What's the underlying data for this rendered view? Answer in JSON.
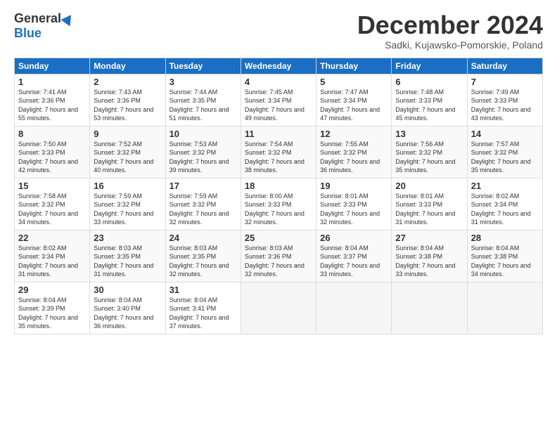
{
  "header": {
    "logo_general": "General",
    "logo_blue": "Blue",
    "month_title": "December 2024",
    "subtitle": "Sadki, Kujawsko-Pomorskie, Poland"
  },
  "days_of_week": [
    "Sunday",
    "Monday",
    "Tuesday",
    "Wednesday",
    "Thursday",
    "Friday",
    "Saturday"
  ],
  "weeks": [
    [
      {
        "day": "1",
        "sunrise": "Sunrise: 7:41 AM",
        "sunset": "Sunset: 3:36 PM",
        "daylight": "Daylight: 7 hours and 55 minutes."
      },
      {
        "day": "2",
        "sunrise": "Sunrise: 7:43 AM",
        "sunset": "Sunset: 3:36 PM",
        "daylight": "Daylight: 7 hours and 53 minutes."
      },
      {
        "day": "3",
        "sunrise": "Sunrise: 7:44 AM",
        "sunset": "Sunset: 3:35 PM",
        "daylight": "Daylight: 7 hours and 51 minutes."
      },
      {
        "day": "4",
        "sunrise": "Sunrise: 7:45 AM",
        "sunset": "Sunset: 3:34 PM",
        "daylight": "Daylight: 7 hours and 49 minutes."
      },
      {
        "day": "5",
        "sunrise": "Sunrise: 7:47 AM",
        "sunset": "Sunset: 3:34 PM",
        "daylight": "Daylight: 7 hours and 47 minutes."
      },
      {
        "day": "6",
        "sunrise": "Sunrise: 7:48 AM",
        "sunset": "Sunset: 3:33 PM",
        "daylight": "Daylight: 7 hours and 45 minutes."
      },
      {
        "day": "7",
        "sunrise": "Sunrise: 7:49 AM",
        "sunset": "Sunset: 3:33 PM",
        "daylight": "Daylight: 7 hours and 43 minutes."
      }
    ],
    [
      {
        "day": "8",
        "sunrise": "Sunrise: 7:50 AM",
        "sunset": "Sunset: 3:33 PM",
        "daylight": "Daylight: 7 hours and 42 minutes."
      },
      {
        "day": "9",
        "sunrise": "Sunrise: 7:52 AM",
        "sunset": "Sunset: 3:32 PM",
        "daylight": "Daylight: 7 hours and 40 minutes."
      },
      {
        "day": "10",
        "sunrise": "Sunrise: 7:53 AM",
        "sunset": "Sunset: 3:32 PM",
        "daylight": "Daylight: 7 hours and 39 minutes."
      },
      {
        "day": "11",
        "sunrise": "Sunrise: 7:54 AM",
        "sunset": "Sunset: 3:32 PM",
        "daylight": "Daylight: 7 hours and 38 minutes."
      },
      {
        "day": "12",
        "sunrise": "Sunrise: 7:55 AM",
        "sunset": "Sunset: 3:32 PM",
        "daylight": "Daylight: 7 hours and 36 minutes."
      },
      {
        "day": "13",
        "sunrise": "Sunrise: 7:56 AM",
        "sunset": "Sunset: 3:32 PM",
        "daylight": "Daylight: 7 hours and 35 minutes."
      },
      {
        "day": "14",
        "sunrise": "Sunrise: 7:57 AM",
        "sunset": "Sunset: 3:32 PM",
        "daylight": "Daylight: 7 hours and 35 minutes."
      }
    ],
    [
      {
        "day": "15",
        "sunrise": "Sunrise: 7:58 AM",
        "sunset": "Sunset: 3:32 PM",
        "daylight": "Daylight: 7 hours and 34 minutes."
      },
      {
        "day": "16",
        "sunrise": "Sunrise: 7:59 AM",
        "sunset": "Sunset: 3:32 PM",
        "daylight": "Daylight: 7 hours and 33 minutes."
      },
      {
        "day": "17",
        "sunrise": "Sunrise: 7:59 AM",
        "sunset": "Sunset: 3:32 PM",
        "daylight": "Daylight: 7 hours and 32 minutes."
      },
      {
        "day": "18",
        "sunrise": "Sunrise: 8:00 AM",
        "sunset": "Sunset: 3:33 PM",
        "daylight": "Daylight: 7 hours and 32 minutes."
      },
      {
        "day": "19",
        "sunrise": "Sunrise: 8:01 AM",
        "sunset": "Sunset: 3:33 PM",
        "daylight": "Daylight: 7 hours and 32 minutes."
      },
      {
        "day": "20",
        "sunrise": "Sunrise: 8:01 AM",
        "sunset": "Sunset: 3:33 PM",
        "daylight": "Daylight: 7 hours and 31 minutes."
      },
      {
        "day": "21",
        "sunrise": "Sunrise: 8:02 AM",
        "sunset": "Sunset: 3:34 PM",
        "daylight": "Daylight: 7 hours and 31 minutes."
      }
    ],
    [
      {
        "day": "22",
        "sunrise": "Sunrise: 8:02 AM",
        "sunset": "Sunset: 3:34 PM",
        "daylight": "Daylight: 7 hours and 31 minutes."
      },
      {
        "day": "23",
        "sunrise": "Sunrise: 8:03 AM",
        "sunset": "Sunset: 3:35 PM",
        "daylight": "Daylight: 7 hours and 31 minutes."
      },
      {
        "day": "24",
        "sunrise": "Sunrise: 8:03 AM",
        "sunset": "Sunset: 3:35 PM",
        "daylight": "Daylight: 7 hours and 32 minutes."
      },
      {
        "day": "25",
        "sunrise": "Sunrise: 8:03 AM",
        "sunset": "Sunset: 3:36 PM",
        "daylight": "Daylight: 7 hours and 32 minutes."
      },
      {
        "day": "26",
        "sunrise": "Sunrise: 8:04 AM",
        "sunset": "Sunset: 3:37 PM",
        "daylight": "Daylight: 7 hours and 33 minutes."
      },
      {
        "day": "27",
        "sunrise": "Sunrise: 8:04 AM",
        "sunset": "Sunset: 3:38 PM",
        "daylight": "Daylight: 7 hours and 33 minutes."
      },
      {
        "day": "28",
        "sunrise": "Sunrise: 8:04 AM",
        "sunset": "Sunset: 3:38 PM",
        "daylight": "Daylight: 7 hours and 34 minutes."
      }
    ],
    [
      {
        "day": "29",
        "sunrise": "Sunrise: 8:04 AM",
        "sunset": "Sunset: 3:39 PM",
        "daylight": "Daylight: 7 hours and 35 minutes."
      },
      {
        "day": "30",
        "sunrise": "Sunrise: 8:04 AM",
        "sunset": "Sunset: 3:40 PM",
        "daylight": "Daylight: 7 hours and 36 minutes."
      },
      {
        "day": "31",
        "sunrise": "Sunrise: 8:04 AM",
        "sunset": "Sunset: 3:41 PM",
        "daylight": "Daylight: 7 hours and 37 minutes."
      },
      null,
      null,
      null,
      null
    ]
  ]
}
